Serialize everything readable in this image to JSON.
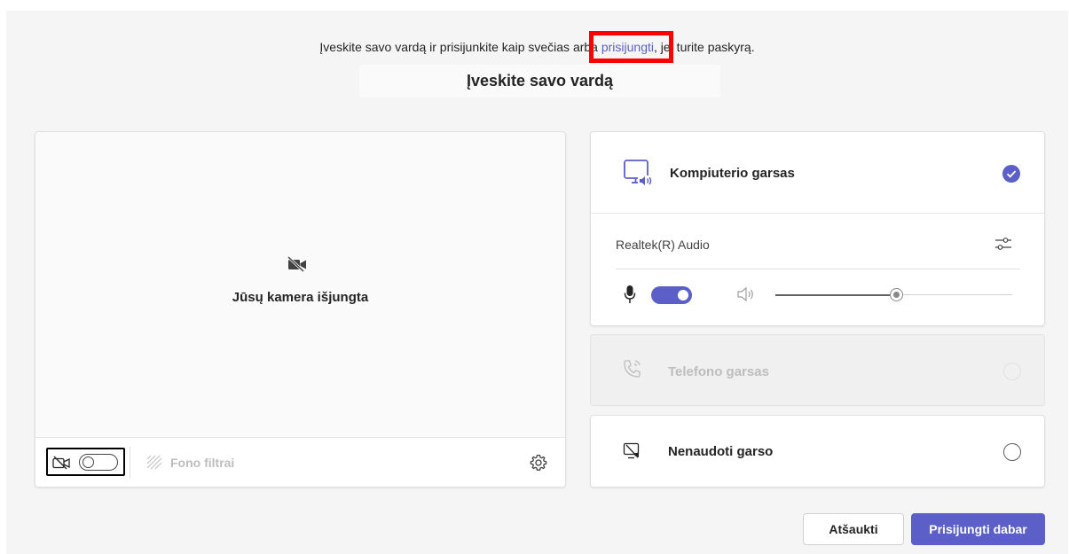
{
  "intro": {
    "before": "Įveskite savo vardą ir prisijunkite kaip svečias arba ",
    "link": "prisijungti",
    "after": ", jei turite paskyrą."
  },
  "name_input": {
    "placeholder": "Įveskite savo vardą",
    "value": ""
  },
  "video": {
    "camera_off_text": "Jūsų kamera išjungta",
    "camera_enabled": false,
    "background_filters_label": "Fono filtrai",
    "icons": [
      "camera-off-icon",
      "background-effects-icon",
      "gear-icon"
    ]
  },
  "audio": {
    "computer_audio": {
      "label": "Kompiuterio garsas",
      "selected": true,
      "icon": "pc-speaker-icon"
    },
    "device": "Realtek(R) Audio",
    "mic_enabled": true,
    "speaker_volume": 0.51,
    "phone_audio": {
      "label": "Telefono garsas",
      "disabled": true,
      "icon": "phone-icon"
    },
    "no_audio": {
      "label": "Nenaudoti garso",
      "selected": false,
      "icon": "no-audio-icon"
    }
  },
  "actions": {
    "cancel": "Atšaukti",
    "join": "Prisijungti dabar"
  },
  "colors": {
    "accent": "#5b5fc7",
    "highlight": "#ff0000",
    "background": "#f5f5f5"
  }
}
